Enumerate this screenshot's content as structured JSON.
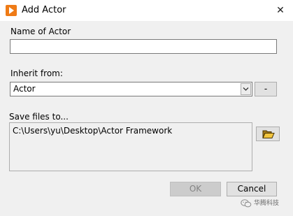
{
  "window": {
    "title": "Add Actor",
    "close_glyph": "✕",
    "app_icon": "labview-arrow-icon"
  },
  "form": {
    "name_label": "Name of Actor",
    "name_value": "",
    "inherit_label": "Inherit from:",
    "inherit_value": "Actor",
    "minus_label": "-",
    "save_label": "Save files to...",
    "save_path": "C:\\Users\\yu\\Desktop\\Actor Framework"
  },
  "buttons": {
    "ok_label": "OK",
    "ok_enabled": false,
    "cancel_label": "Cancel"
  },
  "watermark": {
    "text": "华腾科技",
    "icon": "wechat-icon"
  },
  "colors": {
    "accent": "#ef7b16",
    "disabled_text": "#838383"
  }
}
